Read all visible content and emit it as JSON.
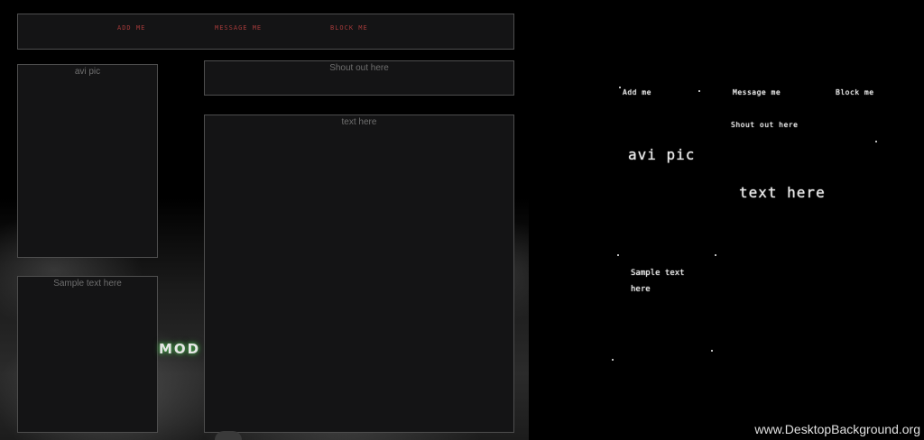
{
  "nav": {
    "add_label": "ADD ME",
    "message_label": "MESSAGE ME",
    "block_label": "BLOCK ME"
  },
  "panels": {
    "avi_label": "avi pic",
    "sample_label": "Sample text here",
    "shout_label": "Shout out here",
    "text_label": "text here"
  },
  "brand_text": "MOD",
  "preview": {
    "add_label": "Add me",
    "message_label": "Message me",
    "block_label": "Block me",
    "shout_label": "Shout out here",
    "avi_label": "avi pic",
    "text_label": "text here",
    "sample_line1": "Sample text",
    "sample_line2": "here"
  },
  "watermark": "www.DesktopBackground.org",
  "colors": {
    "panel_bg": "#141415",
    "panel_border": "#4e4e4e",
    "nav_link": "#a33a3a",
    "brand_glow": "#4caf50"
  }
}
